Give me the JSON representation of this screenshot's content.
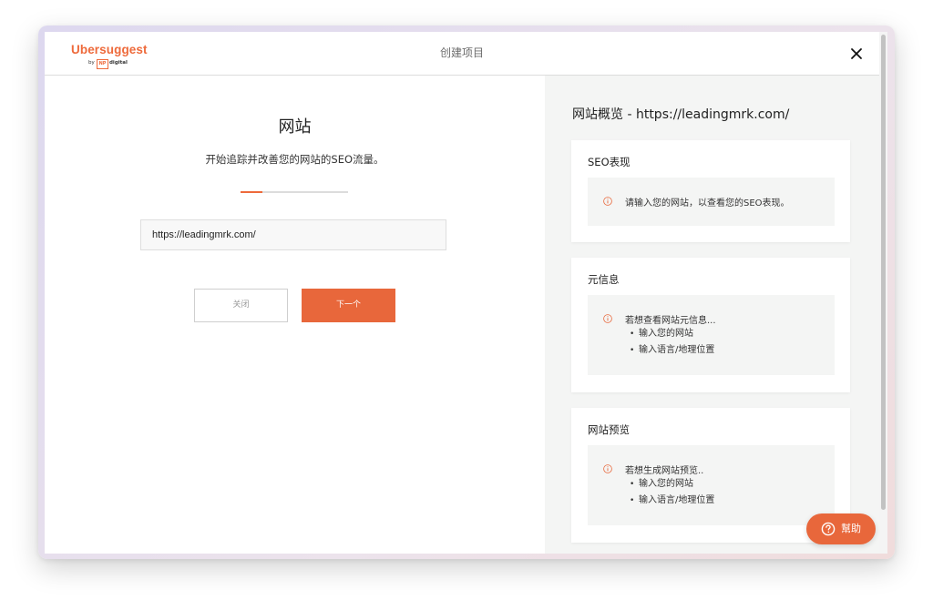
{
  "header": {
    "logo": {
      "name": "Ubersuggest",
      "by": "by",
      "np": "NP",
      "digital": "digital"
    },
    "title": "创建项目",
    "close_icon": "close-icon"
  },
  "left": {
    "title": "网站",
    "subtitle": "开始追踪并改善您的网站的SEO流量。",
    "progress_fraction": 0.2,
    "url_value": "https://leadingmrk.com/",
    "close_label": "关闭",
    "next_label": "下一个"
  },
  "right": {
    "title": "网站概览 - https://leadingmrk.com/",
    "cards": [
      {
        "title": "SEO表现",
        "message": "请输入您的网站，以查看您的SEO表现。",
        "bullets": []
      },
      {
        "title": "元信息",
        "message": "若想查看网站元信息...",
        "bullets": [
          "输入您的网站",
          "输入语言/地理位置"
        ]
      },
      {
        "title": "网站预览",
        "message": "若想生成网站预览..",
        "bullets": [
          "输入您的网站",
          "输入语言/地理位置"
        ]
      }
    ]
  },
  "help": {
    "label": "幫助",
    "icon": "question-circle-icon"
  },
  "colors": {
    "accent": "#e8673b",
    "panel": "#f4f5f4",
    "border": "#dcdcdc"
  }
}
